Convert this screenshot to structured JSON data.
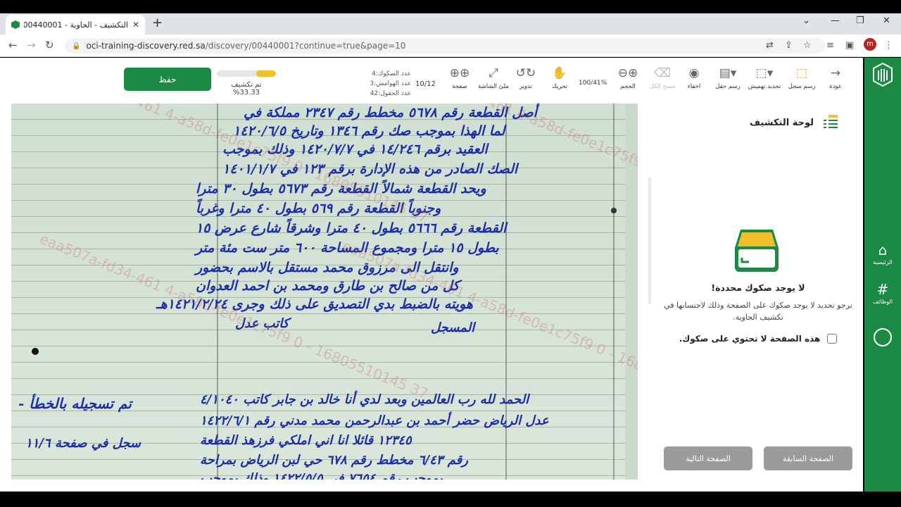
{
  "browser": {
    "tab_title": "التكشيف - الحاوية - 00440001 - 10",
    "url_host": "oci-training-discovery.red.sa",
    "url_path": "/discovery/00440001?continue=true&page=10",
    "profile_initial": "m"
  },
  "toolbar": {
    "save_label": "حفظ",
    "progress_label": "تم تكشيف 33.33%",
    "progress_fraction": 0.33,
    "counts": {
      "deeds": "عدد الصكوك:4",
      "margins": "عدد الهوامش:3",
      "fields": "عدد الحقول:42"
    },
    "page_indicator": "10/12",
    "zoom_value": "100/41%",
    "tools": [
      {
        "label": "عودة",
        "icon": "arrow-right-icon"
      },
      {
        "label": "رسم سجل",
        "icon": "draw-record-icon"
      },
      {
        "label": "تحديد تهميش",
        "icon": "select-margin-icon"
      },
      {
        "label": "رسم حقل",
        "icon": "draw-field-icon"
      },
      {
        "label": "اخفاء",
        "icon": "hide-icon"
      },
      {
        "label": "مسح الكل",
        "icon": "eraser-icon"
      },
      {
        "label": "الحجم",
        "icon": "zoom-icon"
      },
      {
        "label": "تحريك",
        "icon": "hand-icon"
      },
      {
        "label": "تدوير",
        "icon": "rotate-icon"
      },
      {
        "label": "ملئ الشاشة",
        "icon": "fullscreen-icon"
      },
      {
        "label": "صفحة",
        "icon": "page-nav-icon"
      }
    ]
  },
  "panel": {
    "title": "لوحة التكشيف",
    "empty_title": "لا يوجد صكوك محددة!",
    "empty_desc": "نرجو تحديد لا يوجد صكوك على الصفحة وذلك لاحتسابها في تكشيف الحاوية.",
    "checkbox_label": "هذه الصفحة لا تحتوي على صكوك.",
    "prev_button": "الصفحة السابقة",
    "next_button": "الصفحة التالية"
  },
  "sidebar": {
    "home_label": "الرئيسية",
    "functions_label": "الوظائف"
  },
  "document": {
    "watermark": "eaa507a-fd34-461 4-a58d-fe0e1c75f9 0 - 16805510145 37"
  },
  "colors": {
    "brand_green": "#1b8a45",
    "progress_yellow": "#f2c02a",
    "ink_blue": "#1c2fa6"
  }
}
